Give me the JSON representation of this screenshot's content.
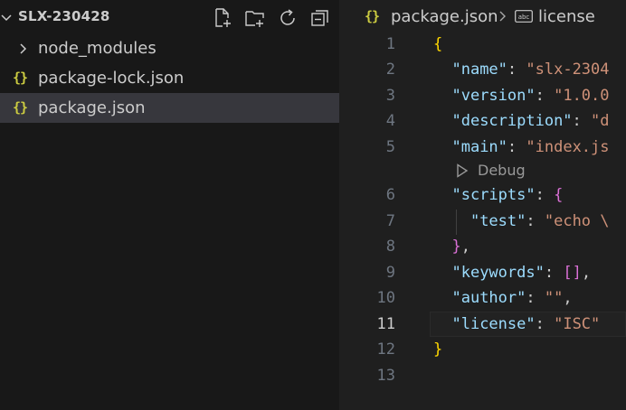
{
  "explorer": {
    "root_label": "SLX-230428",
    "actions": [
      {
        "name": "new-file-icon"
      },
      {
        "name": "new-folder-icon"
      },
      {
        "name": "refresh-icon"
      },
      {
        "name": "collapse-all-icon"
      }
    ],
    "items": [
      {
        "label": "node_modules",
        "type": "folder",
        "icon": "chevron-right-icon"
      },
      {
        "label": "package-lock.json",
        "type": "file",
        "icon_glyph": "{}"
      },
      {
        "label": "package.json",
        "type": "file",
        "icon_glyph": "{}",
        "selected": true
      }
    ]
  },
  "breadcrumb": {
    "icon_glyph": "{}",
    "file": "package.json",
    "separator_icon": "chevron-right-icon",
    "symbol_icon": "string-abc-icon",
    "symbol": "license"
  },
  "codelens": {
    "label": "Debug",
    "icon": "play-icon"
  },
  "editor": {
    "active_line": 11,
    "lines": [
      {
        "num": "1",
        "tokens": [
          {
            "t": "{",
            "c": "b1"
          }
        ]
      },
      {
        "num": "2",
        "tokens": [
          {
            "t": "  ",
            "c": "p"
          },
          {
            "t": "\"name\"",
            "c": "k"
          },
          {
            "t": ": ",
            "c": "p"
          },
          {
            "t": "\"slx-2304",
            "c": "s"
          }
        ]
      },
      {
        "num": "3",
        "tokens": [
          {
            "t": "  ",
            "c": "p"
          },
          {
            "t": "\"version\"",
            "c": "k"
          },
          {
            "t": ": ",
            "c": "p"
          },
          {
            "t": "\"1.0.0",
            "c": "s"
          }
        ]
      },
      {
        "num": "4",
        "tokens": [
          {
            "t": "  ",
            "c": "p"
          },
          {
            "t": "\"description\"",
            "c": "k"
          },
          {
            "t": ": ",
            "c": "p"
          },
          {
            "t": "\"d",
            "c": "s"
          }
        ]
      },
      {
        "num": "5",
        "tokens": [
          {
            "t": "  ",
            "c": "p"
          },
          {
            "t": "\"main\"",
            "c": "k"
          },
          {
            "t": ": ",
            "c": "p"
          },
          {
            "t": "\"index.js",
            "c": "s"
          }
        ]
      },
      {
        "num": "6",
        "tokens": [
          {
            "t": "  ",
            "c": "p"
          },
          {
            "t": "\"scripts\"",
            "c": "k"
          },
          {
            "t": ": ",
            "c": "p"
          },
          {
            "t": "{",
            "c": "b2"
          }
        ]
      },
      {
        "num": "7",
        "tokens": [
          {
            "t": "    ",
            "c": "p"
          },
          {
            "t": "\"test\"",
            "c": "k"
          },
          {
            "t": ": ",
            "c": "p"
          },
          {
            "t": "\"echo \\",
            "c": "s"
          }
        ]
      },
      {
        "num": "8",
        "tokens": [
          {
            "t": "  ",
            "c": "p"
          },
          {
            "t": "}",
            "c": "b2"
          },
          {
            "t": ",",
            "c": "p"
          }
        ]
      },
      {
        "num": "9",
        "tokens": [
          {
            "t": "  ",
            "c": "p"
          },
          {
            "t": "\"keywords\"",
            "c": "k"
          },
          {
            "t": ": ",
            "c": "p"
          },
          {
            "t": "[]",
            "c": "b2"
          },
          {
            "t": ",",
            "c": "p"
          }
        ]
      },
      {
        "num": "10",
        "tokens": [
          {
            "t": "  ",
            "c": "p"
          },
          {
            "t": "\"author\"",
            "c": "k"
          },
          {
            "t": ": ",
            "c": "p"
          },
          {
            "t": "\"\"",
            "c": "s"
          },
          {
            "t": ",",
            "c": "p"
          }
        ]
      },
      {
        "num": "11",
        "tokens": [
          {
            "t": "  ",
            "c": "p"
          },
          {
            "t": "\"license\"",
            "c": "k"
          },
          {
            "t": ": ",
            "c": "p"
          },
          {
            "t": "\"ISC\"",
            "c": "s"
          }
        ]
      },
      {
        "num": "12",
        "tokens": [
          {
            "t": "}",
            "c": "b1"
          }
        ]
      },
      {
        "num": "13",
        "tokens": []
      }
    ]
  },
  "colors": {
    "sidebar_bg": "#181818",
    "editor_bg": "#1f1f1f",
    "selected_bg": "#37373d",
    "json_icon": "#cbcb41",
    "key": "#9cdcfe",
    "string": "#ce9178",
    "bracket_level1": "#ffd700",
    "bracket_level2": "#da70d6"
  }
}
